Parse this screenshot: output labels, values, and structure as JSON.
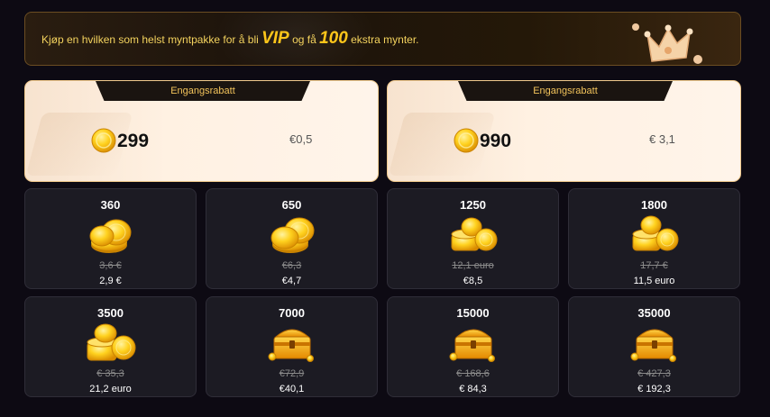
{
  "banner": {
    "text_before": "Kjøp en hvilken som helst myntpakke for å bli ",
    "vip": "VIP",
    "text_middle": " og få ",
    "bonus": "100",
    "text_after": " ekstra mynter."
  },
  "discounts": [
    {
      "tag": "Engangsrabatt",
      "amount": "299",
      "price": "€0,5"
    },
    {
      "tag": "Engangsrabatt",
      "amount": "990",
      "price": "€ 3,1"
    }
  ],
  "packages": [
    {
      "amount": "360",
      "old_price": "3,6 €",
      "price": "2,9 €",
      "icon": "coin-pile-small-icon"
    },
    {
      "amount": "650",
      "old_price": "€6,3",
      "price": "€4,7",
      "icon": "coin-pile-small-icon"
    },
    {
      "amount": "1250",
      "old_price": "12,1 euro",
      "price": "€8,5",
      "icon": "coin-stack-icon"
    },
    {
      "amount": "1800",
      "old_price": "17,7 €",
      "price": "11,5 euro",
      "icon": "coin-stack-icon"
    },
    {
      "amount": "3500",
      "old_price": "€ 35,3",
      "price": "21,2 euro",
      "icon": "coin-stack-large-icon"
    },
    {
      "amount": "7000",
      "old_price": "€72,9",
      "price": "€40,1",
      "icon": "treasure-chest-icon"
    },
    {
      "amount": "15000",
      "old_price": "€ 168,6",
      "price": "€ 84,3",
      "icon": "treasure-chest-icon"
    },
    {
      "amount": "35000",
      "old_price": "€ 427,3",
      "price": "€ 192,3",
      "icon": "treasure-chest-icon"
    }
  ],
  "colors": {
    "gold": "#ffc61a",
    "card_bg": "#1c1b23",
    "page_bg": "#0d0a13"
  }
}
